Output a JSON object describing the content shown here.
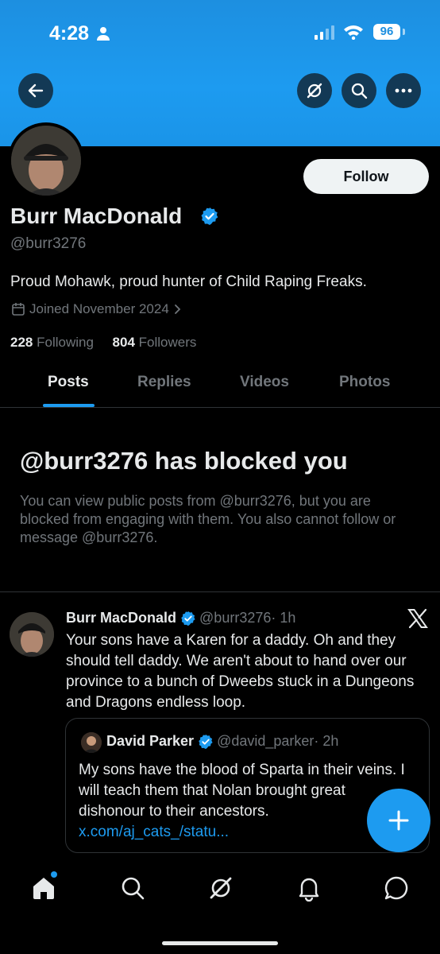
{
  "status_bar": {
    "time": "4:28",
    "battery": "96"
  },
  "profile": {
    "name": "Burr MacDonald",
    "handle": "@burr3276",
    "bio": "Proud Mohawk, proud hunter of Child Raping Freaks.",
    "joined": "Joined November 2024",
    "following_count": "228",
    "following_label": "Following",
    "followers_count": "804",
    "followers_label": "Followers",
    "follow_button": "Follow"
  },
  "tabs": [
    {
      "label": "Posts",
      "active": true
    },
    {
      "label": "Replies",
      "active": false
    },
    {
      "label": "Videos",
      "active": false
    },
    {
      "label": "Photos",
      "active": false
    }
  ],
  "blocked": {
    "title": "@burr3276 has blocked you",
    "description": "You can view public posts from @burr3276, but you are blocked from engaging with them. You also cannot follow or message @burr3276."
  },
  "post": {
    "author": "Burr MacDonald",
    "handle": "@burr3276",
    "time": "· 1h",
    "text": "Your sons have a Karen for a daddy. Oh and they should tell daddy. We aren't about to hand over our province to a bunch of Dweebs stuck in a Dungeons and Dragons endless loop.",
    "quote": {
      "author": "David Parker",
      "handle": "@david_parker",
      "time": "· 2h",
      "text": "My sons have the blood of Sparta in their veins. I will teach them that Nolan brought great dishonour to their ancestors. ",
      "link": "x.com/aj_cats_/statu..."
    }
  },
  "icons": {
    "back": "arrow-left-icon",
    "grok": "grok-icon",
    "search": "search-icon",
    "more": "more-dots-icon",
    "verified": "verified-badge-icon",
    "calendar": "calendar-icon",
    "x": "x-logo-icon",
    "compose": "plus-icon",
    "nav": [
      "home-icon",
      "search-icon",
      "grok-icon",
      "bell-icon",
      "messages-icon"
    ]
  },
  "colors": {
    "accent": "#1d9bf0",
    "banner": "#1d9bf0",
    "background": "#000000",
    "muted": "#71767b"
  }
}
